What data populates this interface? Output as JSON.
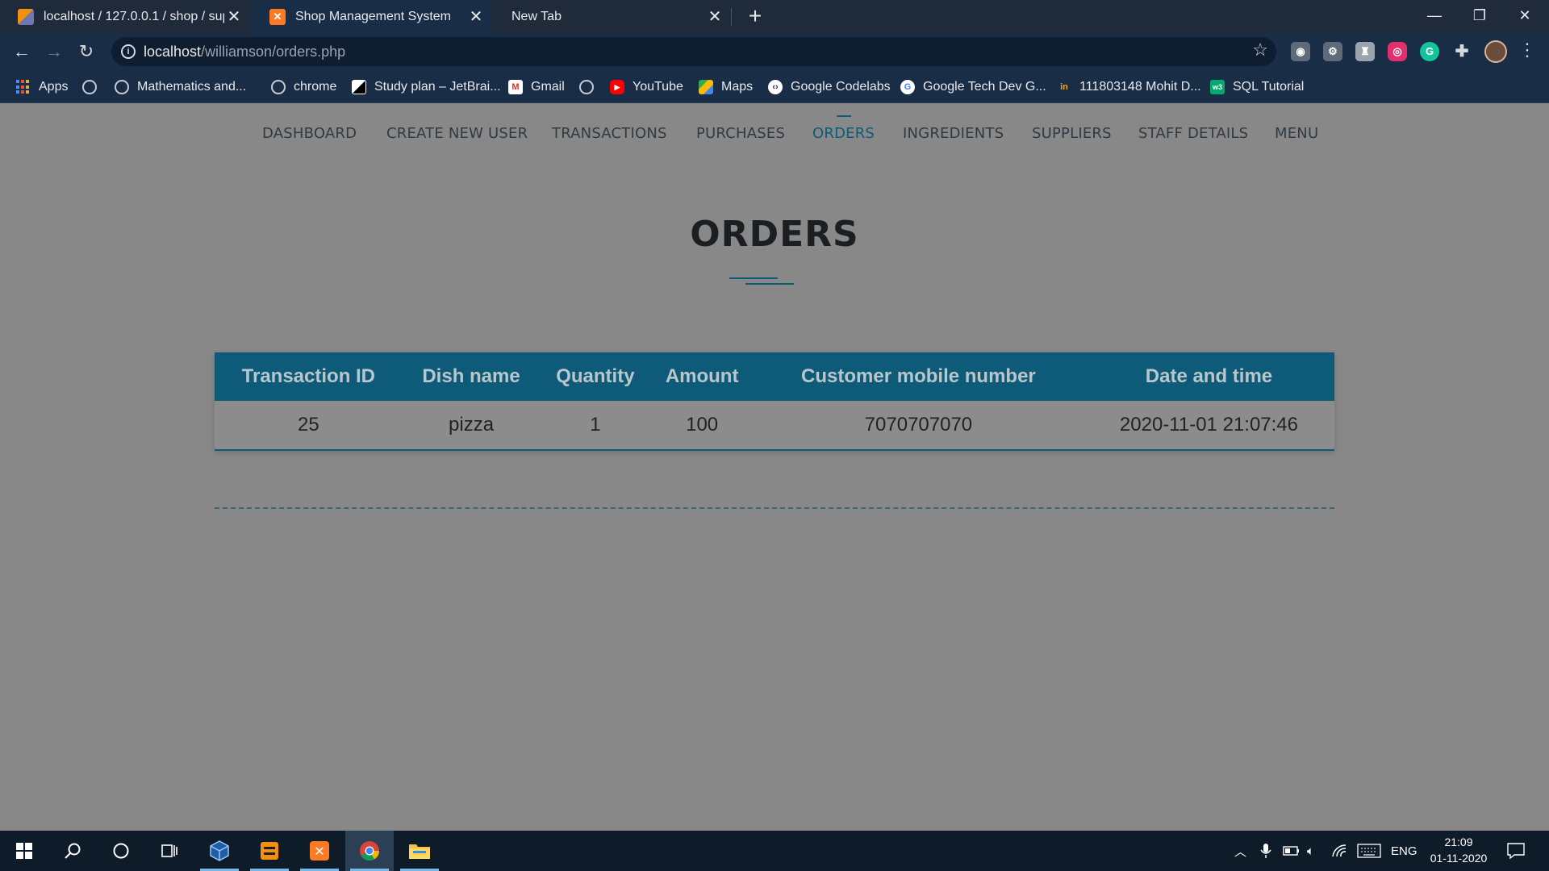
{
  "browser": {
    "tabs": [
      {
        "title": "localhost / 127.0.0.1 / shop / sup",
        "icon": "phpmyadmin-icon"
      },
      {
        "title": "Shop Management System",
        "icon": "xampp-icon"
      },
      {
        "title": "New Tab",
        "icon": ""
      }
    ],
    "new_tab_label": "+",
    "url_host": "localhost",
    "url_path": "/williamson/orders.php",
    "bookmarks": [
      {
        "label": "Apps",
        "icon": "apps-grid-icon"
      },
      {
        "label": "",
        "icon": "globe-icon"
      },
      {
        "label": "Mathematics and...",
        "icon": "globe-icon"
      },
      {
        "label": "chrome",
        "icon": "globe-icon"
      },
      {
        "label": "Study plan – JetBrai...",
        "icon": "jetbrains-icon"
      },
      {
        "label": "Gmail",
        "icon": "gmail-icon"
      },
      {
        "label": "",
        "icon": "globe-icon"
      },
      {
        "label": "YouTube",
        "icon": "youtube-icon"
      },
      {
        "label": "Maps",
        "icon": "maps-icon"
      },
      {
        "label": "Google Codelabs",
        "icon": "codelabs-icon"
      },
      {
        "label": "Google Tech Dev G...",
        "icon": "google-icon"
      },
      {
        "label": "111803148 Mohit D...",
        "icon": "coursera-icon"
      },
      {
        "label": "SQL Tutorial",
        "icon": "w3schools-icon"
      }
    ]
  },
  "nav": {
    "items": [
      "DASHBOARD",
      "CREATE NEW USER",
      "TRANSACTIONS",
      "PURCHASES",
      "ORDERS",
      "INGREDIENTS",
      "SUPPLIERS",
      "STAFF DETAILS",
      "MENU"
    ],
    "active": "ORDERS"
  },
  "page": {
    "title": "ORDERS"
  },
  "orders_table": {
    "headers": [
      "Transaction ID",
      "Dish name",
      "Quantity",
      "Amount",
      "Customer mobile number",
      "Date and time"
    ],
    "rows": [
      [
        "25",
        "pizza",
        "1",
        "100",
        "7070707070",
        "2020-11-01 21:07:46"
      ]
    ]
  },
  "taskbar": {
    "language": "ENG",
    "time": "21:09",
    "date": "01-11-2020"
  },
  "colors": {
    "accent": "#0d5b78",
    "page_bg": "#888888",
    "chrome_bg": "#1a2d47",
    "taskbar_bg": "#0e1b29"
  }
}
